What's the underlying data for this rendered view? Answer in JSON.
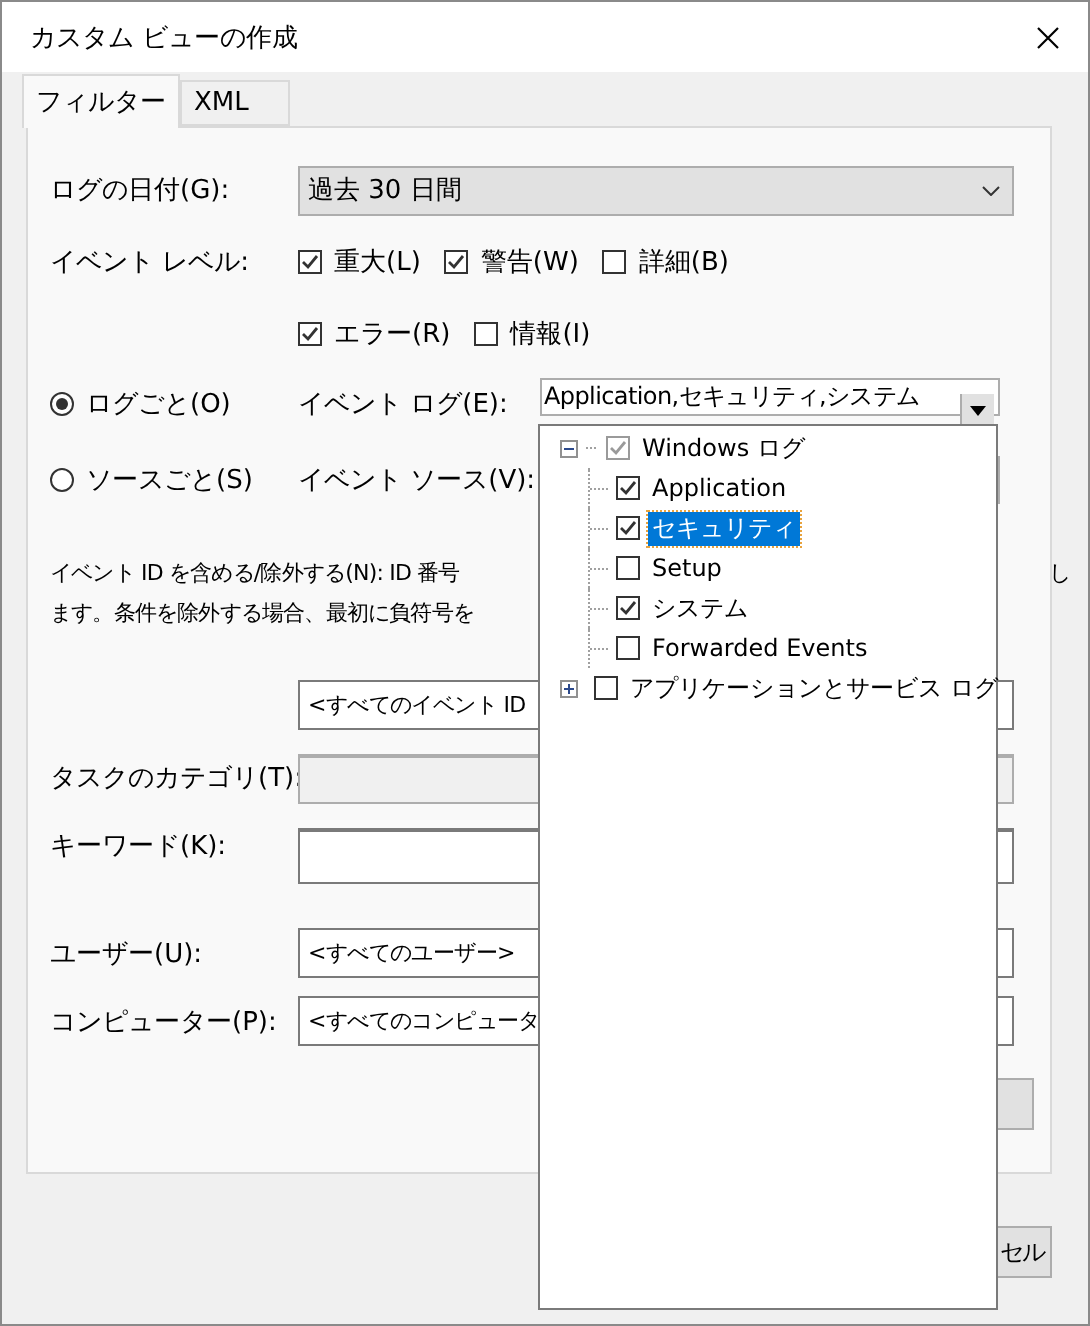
{
  "window": {
    "title": "カスタム ビューの作成"
  },
  "tabs": [
    {
      "label": "フィルター",
      "selected": true
    },
    {
      "label": "XML",
      "selected": false
    }
  ],
  "logged": {
    "label": "ログの日付(G):",
    "value": "過去 30 日間"
  },
  "event_level": {
    "label": "イベント レベル:",
    "rows": [
      [
        {
          "label": "重大(L)",
          "checked": true
        },
        {
          "label": "警告(W)",
          "checked": true
        },
        {
          "label": "詳細(B)",
          "checked": false
        }
      ],
      [
        {
          "label": "エラー(R)",
          "checked": true
        },
        {
          "label": "情報(I)",
          "checked": false
        }
      ]
    ]
  },
  "source_mode": [
    {
      "label": "ログごと(O)",
      "selected": true,
      "field_label": "イベント ログ(E):",
      "value": "Application,セキュリティ,システム"
    },
    {
      "label": "ソースごと(S)",
      "selected": false,
      "field_label": "イベント ソース(V):"
    }
  ],
  "event_id": {
    "description": "イベント ID を含める/除外する(N): ID 番号",
    "description_line_2": "ます。条件を除外する場合、最初に負符号を",
    "description_tail": "し",
    "value": "<すべてのイベント ID"
  },
  "task_category": {
    "label": "タスクのカテゴリ(T):"
  },
  "keywords": {
    "label": "キーワード(K):"
  },
  "user": {
    "label": "ユーザー(U):",
    "value": "<すべてのユーザー>"
  },
  "computer": {
    "label": "コンピューター(P):",
    "value": "<すべてのコンピュータ"
  },
  "buttons": [
    {
      "label": "セル"
    }
  ],
  "log_tree": [
    {
      "label": "Windows ログ",
      "checked": true,
      "partial": true,
      "expanded": true,
      "selected": false,
      "children": [
        {
          "label": "Application",
          "checked": true,
          "selected": false
        },
        {
          "label": "セキュリティ",
          "checked": true,
          "selected": true
        },
        {
          "label": "Setup",
          "checked": false,
          "selected": false
        },
        {
          "label": "システム",
          "checked": true,
          "selected": false
        },
        {
          "label": "Forwarded Events",
          "checked": false,
          "selected": false
        }
      ]
    },
    {
      "label": "アプリケーションとサービス ログ",
      "checked": false,
      "partial": false,
      "expanded": false,
      "selected": false
    }
  ]
}
